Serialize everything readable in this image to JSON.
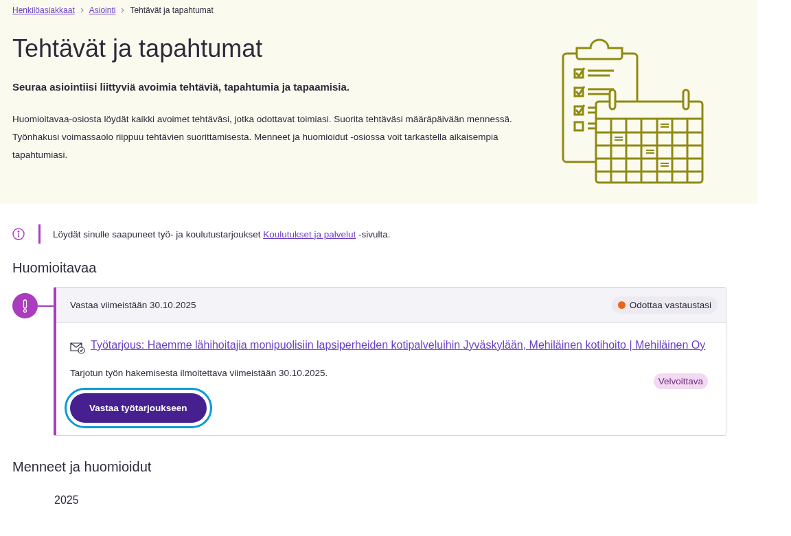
{
  "breadcrumb": [
    {
      "label": "Henkilöasiakkaat",
      "link": true
    },
    {
      "label": "Asiointi",
      "link": true
    },
    {
      "label": "Tehtävät ja tapahtumat",
      "link": false
    }
  ],
  "hero": {
    "title": "Tehtävät ja tapahtumat",
    "lead": "Seuraa asiointiisi liittyviä avoimia tehtäviä, tapahtumia ja tapaamisia.",
    "body": "Huomioitavaa-osiosta löydät kaikki avoimet tehtäväsi, jotka odottavat toimiasi. Suorita tehtäväsi määräpäivään mennessä. Työnhakusi voimassaolo riippuu tehtävien suorittamisesta. Menneet ja huomioidut -osiossa voit tarkastella aikaisempia tapahtumiasi."
  },
  "notice": {
    "before": "Löydät sinulle saapuneet työ- ja koulutustarjoukset",
    "link": "Koulutukset ja palvelut",
    "after": "-sivulta."
  },
  "attention": {
    "heading": "Huomioitavaa",
    "tasks": [
      {
        "deadline": "Vastaa viimeistään 30.10.2025",
        "status": "Odottaa vastaustasi",
        "title": "Työtarjous: Haemme lähihoitajia monipuolisiin lapsiperheiden kotipalveluihin Jyväskylään, Mehiläinen kotihoito | Mehiläinen Oy",
        "description": "Tarjotun työn hakemisesta ilmoitettava viimeistään 30.10.2025.",
        "tag": "Velvoittava",
        "button": {
          "label": "Vastaa työtarjoukseen",
          "focused": true
        }
      }
    ]
  },
  "past": {
    "heading": "Menneet ja huomioidut",
    "year": "2025"
  }
}
